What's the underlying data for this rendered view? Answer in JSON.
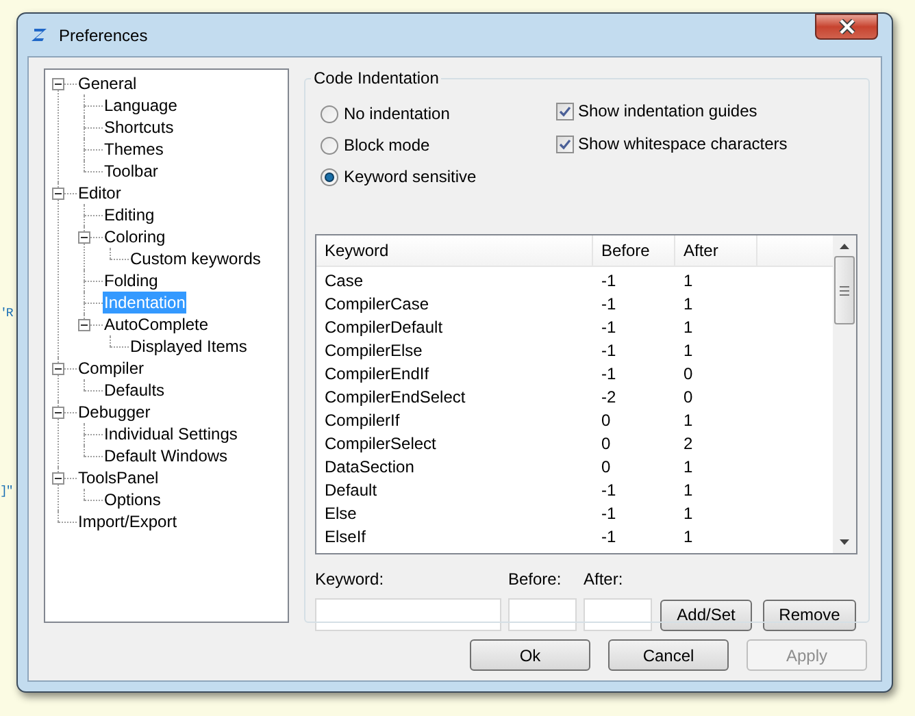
{
  "window": {
    "title": "Preferences"
  },
  "background_fragments": [
    "'R",
    "]\""
  ],
  "tree": [
    {
      "label": "General",
      "expanded": true,
      "selected": false,
      "children": [
        {
          "label": "Language",
          "selected": false
        },
        {
          "label": "Shortcuts",
          "selected": false
        },
        {
          "label": "Themes",
          "selected": false
        },
        {
          "label": "Toolbar",
          "selected": false
        }
      ]
    },
    {
      "label": "Editor",
      "expanded": true,
      "selected": false,
      "children": [
        {
          "label": "Editing",
          "selected": false
        },
        {
          "label": "Coloring",
          "expanded": true,
          "selected": false,
          "children": [
            {
              "label": "Custom keywords",
              "selected": false
            }
          ]
        },
        {
          "label": "Folding",
          "selected": false
        },
        {
          "label": "Indentation",
          "selected": true
        },
        {
          "label": "AutoComplete",
          "expanded": true,
          "selected": false,
          "children": [
            {
              "label": "Displayed Items",
              "selected": false
            }
          ]
        }
      ]
    },
    {
      "label": "Compiler",
      "expanded": true,
      "selected": false,
      "children": [
        {
          "label": "Defaults",
          "selected": false
        }
      ]
    },
    {
      "label": "Debugger",
      "expanded": true,
      "selected": false,
      "children": [
        {
          "label": "Individual Settings",
          "selected": false
        },
        {
          "label": "Default Windows",
          "selected": false
        }
      ]
    },
    {
      "label": "ToolsPanel",
      "expanded": true,
      "selected": false,
      "children": [
        {
          "label": "Options",
          "selected": false
        }
      ]
    },
    {
      "label": "Import/Export",
      "selected": false
    }
  ],
  "group": {
    "title": "Code Indentation",
    "modes": [
      {
        "label": "No indentation",
        "selected": false
      },
      {
        "label": "Block mode",
        "selected": false
      },
      {
        "label": "Keyword sensitive",
        "selected": true
      }
    ],
    "options": [
      {
        "label": "Show indentation guides",
        "checked": true
      },
      {
        "label": "Show whitespace characters",
        "checked": true
      }
    ]
  },
  "table": {
    "columns": [
      "Keyword",
      "Before",
      "After"
    ],
    "rows": [
      [
        "Case",
        "-1",
        "1"
      ],
      [
        "CompilerCase",
        "-1",
        "1"
      ],
      [
        "CompilerDefault",
        "-1",
        "1"
      ],
      [
        "CompilerElse",
        "-1",
        "1"
      ],
      [
        "CompilerEndIf",
        "-1",
        "0"
      ],
      [
        "CompilerEndSelect",
        "-2",
        "0"
      ],
      [
        "CompilerIf",
        "0",
        "1"
      ],
      [
        "CompilerSelect",
        "0",
        "2"
      ],
      [
        "DataSection",
        "0",
        "1"
      ],
      [
        "Default",
        "-1",
        "1"
      ],
      [
        "Else",
        "-1",
        "1"
      ],
      [
        "ElseIf",
        "-1",
        "1"
      ]
    ]
  },
  "editor": {
    "keyword_label": "Keyword:",
    "before_label": "Before:",
    "after_label": "After:",
    "add_button": "Add/Set",
    "remove_button": "Remove"
  },
  "buttons": [
    {
      "label": "Ok",
      "disabled": false
    },
    {
      "label": "Cancel",
      "disabled": false
    },
    {
      "label": "Apply",
      "disabled": true
    }
  ]
}
